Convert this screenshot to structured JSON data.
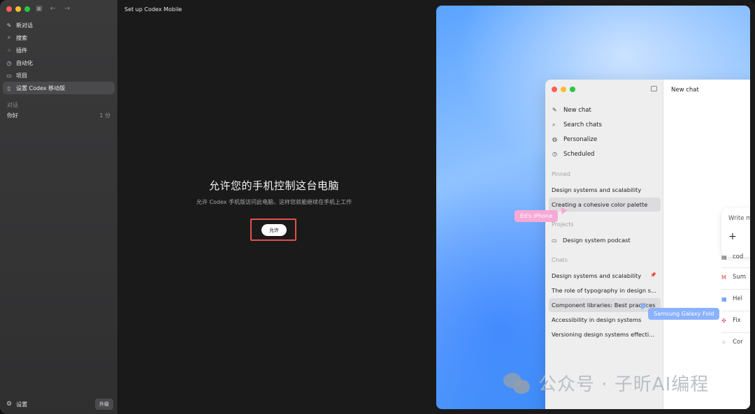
{
  "sidebar": {
    "nav": [
      {
        "label": "新对话",
        "icon": "new-chat-icon"
      },
      {
        "label": "搜索",
        "icon": "search-icon"
      },
      {
        "label": "插件",
        "icon": "plugins-icon"
      },
      {
        "label": "自动化",
        "icon": "clock-icon"
      },
      {
        "label": "项目",
        "icon": "folder-icon"
      },
      {
        "label": "设置 Codex 移动版",
        "icon": "phone-icon"
      }
    ],
    "section_label": "对话",
    "chats": [
      {
        "title": "你好",
        "time": "1 分"
      }
    ],
    "settings_label": "设置",
    "upgrade_label": "升级"
  },
  "main": {
    "title": "Set up Codex Mobile",
    "hero_title": "允许您的手机控制这台电脑",
    "hero_subtitle": "允许 Codex 手机版访问此电脑，这样您就能继续在手机上工作",
    "allow_label": "允许"
  },
  "illustration": {
    "nav": [
      {
        "label": "New chat",
        "icon": "edit-icon"
      },
      {
        "label": "Search chats",
        "icon": "search-icon"
      },
      {
        "label": "Personalize",
        "icon": "palette-icon"
      },
      {
        "label": "Scheduled",
        "icon": "clock-icon"
      }
    ],
    "pinned_label": "Pinned",
    "pinned": [
      "Design systems and scalability",
      "Creating a cohesive color palette"
    ],
    "projects_label": "Projects",
    "projects": [
      "Design system podcast"
    ],
    "chats_label": "Chats",
    "chats": [
      "Design systems and scalability",
      "The role of typography in design s...",
      "Component libraries: Best practices",
      "Accessibility in design systems",
      "Versioning design systems effecti..."
    ],
    "header": "New chat",
    "device_pink": "Ed's iPhone",
    "device_blue": "Samsung Galaxy Fold",
    "compose_placeholder": "Write m",
    "suggestions": [
      {
        "label": "cod",
        "icon": "code-icon"
      },
      {
        "label": "Sum",
        "icon": "gmail-icon"
      },
      {
        "label": "Hel",
        "icon": "app-icon"
      },
      {
        "label": "Fix",
        "icon": "slack-icon"
      },
      {
        "label": "Cor",
        "icon": "grid-icon"
      }
    ]
  },
  "watermark": "公众号 · 子昕AI编程",
  "colors": {
    "highlight_box": "#e0524a",
    "sidebar_bg": "#363637",
    "main_bg": "#1a1a1a"
  }
}
